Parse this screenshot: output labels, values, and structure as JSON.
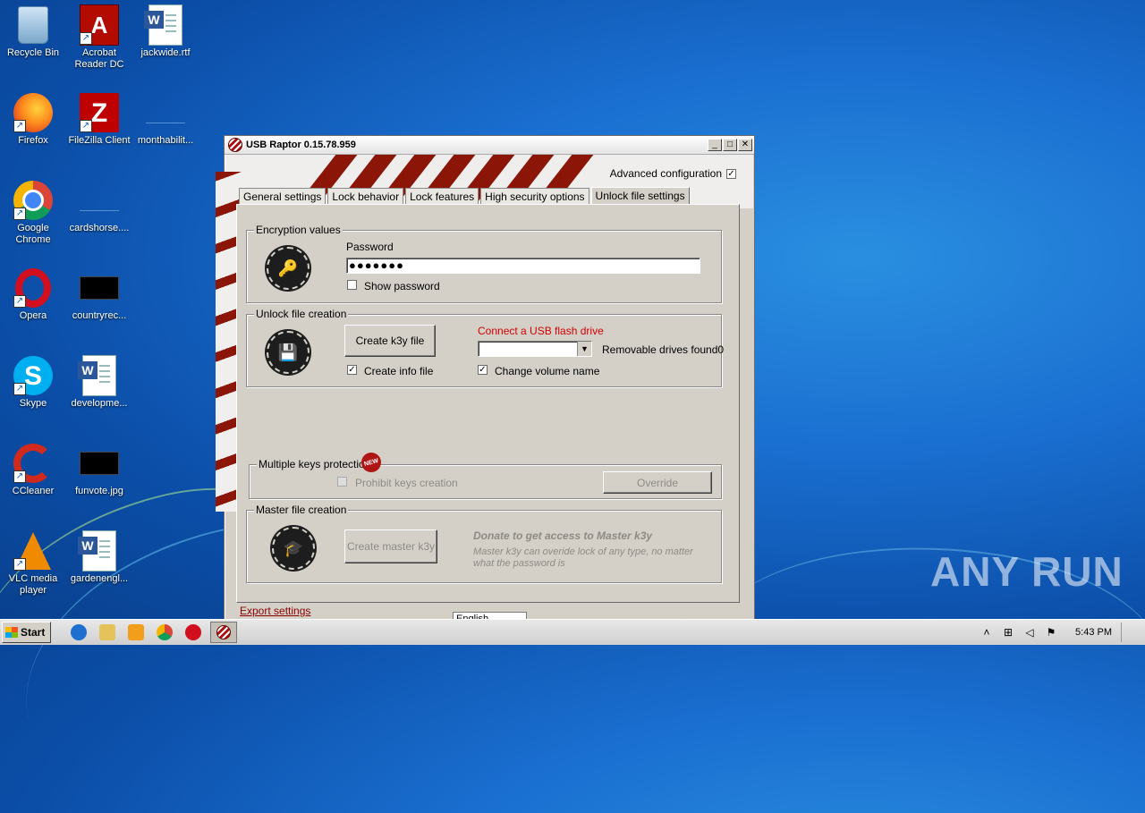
{
  "desktop": {
    "icons": [
      {
        "label": "Recycle Bin",
        "icon": "recycle-bin-icon"
      },
      {
        "label": "Acrobat Reader DC",
        "icon": "acrobat-icon"
      },
      {
        "label": "jackwide.rtf",
        "icon": "word-doc-icon"
      },
      {
        "label": "Firefox",
        "icon": "firefox-icon"
      },
      {
        "label": "FileZilla Client",
        "icon": "filezilla-icon"
      },
      {
        "label": "monthabilit...",
        "icon": "blank-file-icon"
      },
      {
        "label": "Google Chrome",
        "icon": "chrome-icon"
      },
      {
        "label": "cardshorse....",
        "icon": "blank-file-icon"
      },
      {
        "label": "Opera",
        "icon": "opera-icon"
      },
      {
        "label": "countryrec...",
        "icon": "image-thumb-icon"
      },
      {
        "label": "Skype",
        "icon": "skype-icon"
      },
      {
        "label": "developme...",
        "icon": "word-doc-icon"
      },
      {
        "label": "CCleaner",
        "icon": "ccleaner-icon"
      },
      {
        "label": "funvote.jpg",
        "icon": "image-thumb-icon"
      },
      {
        "label": "VLC media player",
        "icon": "vlc-icon"
      },
      {
        "label": "gardenengl...",
        "icon": "word-doc-icon"
      }
    ]
  },
  "window": {
    "title": "USB Raptor 0.15.78.959",
    "controls": {
      "minimize": "_",
      "maximize": "□",
      "close": "✕"
    },
    "advanced_config_label": "Advanced configuration",
    "advanced_config_checked": true,
    "tabs": [
      {
        "label": "General settings",
        "active": false
      },
      {
        "label": "Lock behavior",
        "active": false
      },
      {
        "label": "Lock features",
        "active": false
      },
      {
        "label": "High security options",
        "active": false
      },
      {
        "label": "Unlock file settings",
        "active": true
      }
    ],
    "encryption": {
      "legend": "Encryption values",
      "password_label": "Password",
      "password_value": "●●●●●●●",
      "show_password_label": "Show password",
      "show_password_checked": false
    },
    "unlock_file": {
      "legend": "Unlock file creation",
      "create_button": "Create k3y file",
      "create_info_label": "Create info file",
      "create_info_checked": true,
      "connect_usb_label": "Connect a USB flash drive",
      "drive_select_value": "",
      "removable_found_label": "Removable drives found0",
      "change_volume_label": "Change volume name",
      "change_volume_checked": true
    },
    "multiple_keys": {
      "legend": "Multiple keys protection",
      "new_badge": "NEW",
      "prohibit_label": "Prohibit keys creation",
      "prohibit_checked": false,
      "override_button": "Override"
    },
    "master_file": {
      "legend": "Master file creation",
      "create_master_button": "Create master k3y",
      "donate_title": "Donate to get access to Master k3y",
      "donate_text": "Master k3y can overide lock of any type, no matter what the password is"
    },
    "export_link": "Export settings",
    "language_value": "English"
  },
  "watermark": {
    "text": "ANY RUN"
  },
  "taskbar": {
    "start_label": "Start",
    "clock": "5:43 PM"
  },
  "colors": {
    "accent_red": "#d40000",
    "dialog_bg": "#d4d0c8",
    "desktop_blue": "#1a6fd0"
  }
}
